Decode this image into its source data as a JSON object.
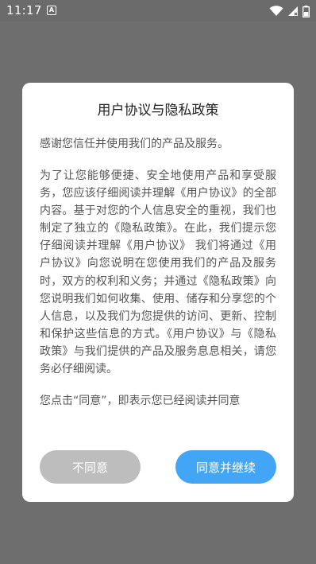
{
  "status_bar": {
    "time": "11:17",
    "notification_icon": "a-icon",
    "wifi_icon": "wifi-icon",
    "signal_icon": "signal-icon",
    "battery_icon": "battery-icon",
    "notification_letter": "A"
  },
  "dialog": {
    "title": "用户协议与隐私政策",
    "intro": "感谢您信任并使用我们的产品及服务。",
    "body": "为了让您能够便捷、安全地使用产品和享受服务，您应该仔细阅读并理解《用户协议》的全部内容。基于对您的个人信息安全的重视，我们也制定了独立的《隐私政策》。在此，我们提示您仔细阅读并理解《用户协议》 我们将通过《用户协议》向您说明在您使用我们的产品及服务时，双方的权利和义务；并通过《隐私政策》向您说明我们如何收集、使用、储存和分享您的个人信息，以及我们为您提供的访问、更新、控制和保护这些信息的方式。《用户协议》与《隐私政策》与我们提供的产品及服务息息相关，请您务必仔细阅读。",
    "footer_text": "您点击“同意”，即表示您已经阅读并同意",
    "disagree_label": "不同意",
    "agree_label": "同意并继续"
  },
  "colors": {
    "agree_button": "#42a5f5",
    "disagree_button": "#bdbdbd",
    "overlay": "#6e6e6e"
  }
}
